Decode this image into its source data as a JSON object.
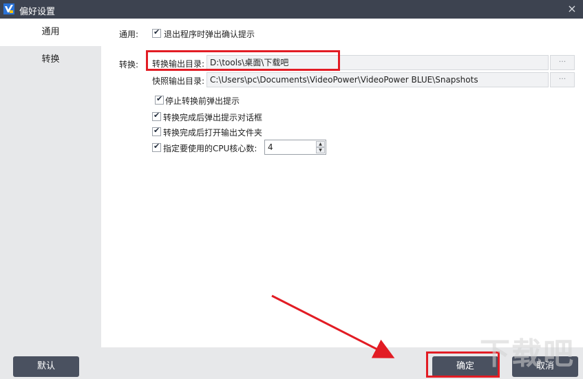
{
  "window": {
    "title": "偏好设置",
    "close_icon": "×"
  },
  "sidebar": {
    "items": [
      {
        "label": "通用"
      },
      {
        "label": "转换"
      }
    ]
  },
  "general": {
    "section_label": "通用:",
    "exit_confirm": {
      "label": "退出程序时弹出确认提示",
      "checked": true
    }
  },
  "convert": {
    "section_label": "转换:",
    "output_dir": {
      "label": "转换输出目录:",
      "value": "D:\\tools\\桌面\\下载吧",
      "browse_label": "···"
    },
    "snapshot_dir": {
      "label": "快照输出目录:",
      "value": "C:\\Users\\pc\\Documents\\VideoPower\\VideoPower BLUE\\Snapshots",
      "browse_label": "···"
    },
    "options": [
      {
        "label": "停止转换前弹出提示",
        "checked": true
      },
      {
        "label": "转换完成后弹出提示对话框",
        "checked": true
      },
      {
        "label": "转换完成后打开输出文件夹",
        "checked": true
      },
      {
        "label": "指定要使用的CPU核心数:",
        "checked": true
      }
    ],
    "cpu_cores": "4"
  },
  "footer": {
    "default_label": "默认",
    "ok_label": "确定",
    "cancel_label": "取消"
  },
  "watermark": "下载吧",
  "colors": {
    "titlebar": "#3d4350",
    "sidebar": "#e7e8ea",
    "button": "#4a5160",
    "highlight": "#e21c24"
  }
}
